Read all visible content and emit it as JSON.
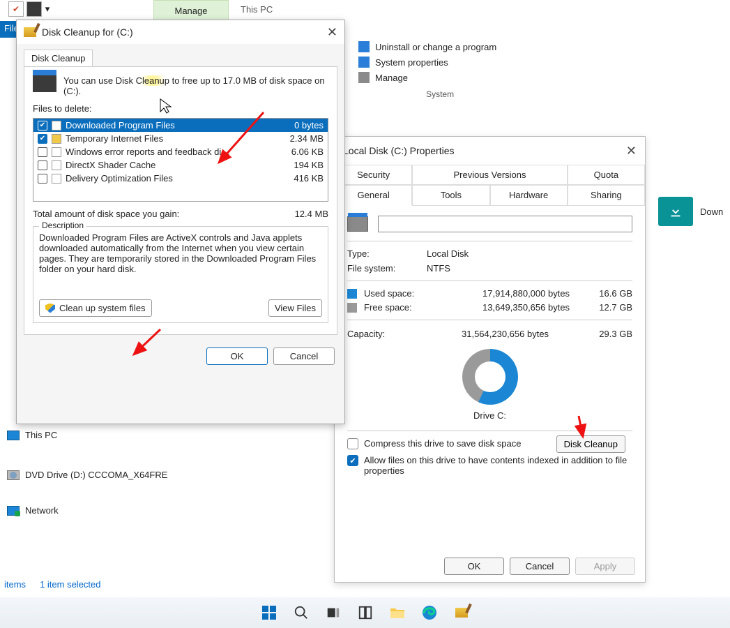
{
  "topbar": {
    "manage": "Manage",
    "thispc": "This PC",
    "file": "File"
  },
  "system_menu": {
    "uninstall": "Uninstall or change a program",
    "properties": "System properties",
    "manage": "Manage",
    "caption": "System"
  },
  "downloads_tile": "Down",
  "tree": {
    "thispc": "This PC",
    "dvd": "DVD Drive (D:) CCCOMA_X64FRE",
    "network": "Network"
  },
  "statusbar": {
    "items": "items",
    "selected": "1 item selected"
  },
  "properties_dialog": {
    "title": "Local Disk (C:) Properties",
    "tabs_row1": [
      "Security",
      "Previous Versions",
      "Quota"
    ],
    "tabs_row2": [
      "General",
      "Tools",
      "Hardware",
      "Sharing"
    ],
    "drive_name": "",
    "type_label": "Type:",
    "type_val": "Local Disk",
    "fs_label": "File system:",
    "fs_val": "NTFS",
    "used_label": "Used space:",
    "used_bytes": "17,914,880,000 bytes",
    "used_human": "16.6 GB",
    "free_label": "Free space:",
    "free_bytes": "13,649,350,656 bytes",
    "free_human": "12.7 GB",
    "cap_label": "Capacity:",
    "cap_bytes": "31,564,230,656 bytes",
    "cap_human": "29.3 GB",
    "drive_caption": "Drive C:",
    "disk_cleanup_btn": "Disk Cleanup",
    "compress": "Compress this drive to save disk space",
    "index": "Allow files on this drive to have contents indexed in addition to file properties",
    "ok": "OK",
    "cancel": "Cancel",
    "apply": "Apply"
  },
  "cleanup_dialog": {
    "title": "Disk Cleanup for  (C:)",
    "tab": "Disk Cleanup",
    "intro_a": "You can use Disk ",
    "intro_hl": "Cleanup",
    "intro_b": " to free up to 17.0 MB of disk space on  (C:).",
    "files_label": "Files to delete:",
    "items": [
      {
        "checked": true,
        "selected": true,
        "name": "Downloaded Program Files",
        "size": "0 bytes"
      },
      {
        "checked": true,
        "selected": false,
        "name": "Temporary Internet Files",
        "size": "2.34 MB",
        "lock": true
      },
      {
        "checked": false,
        "selected": false,
        "name": "Windows error reports and feedback di…",
        "size": "6.06 KB"
      },
      {
        "checked": false,
        "selected": false,
        "name": "DirectX Shader Cache",
        "size": "194 KB"
      },
      {
        "checked": false,
        "selected": false,
        "name": "Delivery Optimization Files",
        "size": "416 KB"
      }
    ],
    "total_label": "Total amount of disk space you gain:",
    "total_val": "12.4 MB",
    "desc_label": "Description",
    "desc": "Downloaded Program Files are ActiveX controls and Java applets downloaded automatically from the Internet when you view certain pages. They are temporarily stored in the Downloaded Program Files folder on your hard disk.",
    "clean_system": "Clean up system files",
    "view_files": "View Files",
    "ok": "OK",
    "cancel": "Cancel"
  }
}
